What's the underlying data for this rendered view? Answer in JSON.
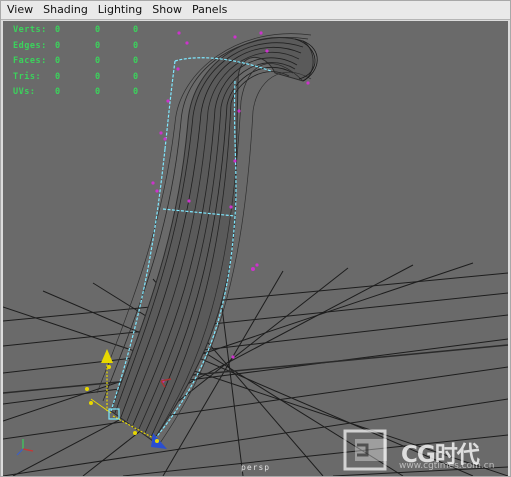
{
  "menubar": {
    "items": [
      "View",
      "Shading",
      "Lighting",
      "Show",
      "Panels"
    ]
  },
  "hud": {
    "rows": [
      {
        "label": "Verts:",
        "values": [
          "0",
          "0",
          "0"
        ]
      },
      {
        "label": "Edges:",
        "values": [
          "0",
          "0",
          "0"
        ]
      },
      {
        "label": "Faces:",
        "values": [
          "0",
          "0",
          "0"
        ]
      },
      {
        "label": "Tris:",
        "values": [
          "0",
          "0",
          "0"
        ]
      },
      {
        "label": "UVs:",
        "values": [
          "0",
          "0",
          "0"
        ]
      }
    ]
  },
  "viewport": {
    "camera_label": "persp",
    "background": "#6a6a6a",
    "grid_color": "#1d1d1d",
    "axis_x_color": "#a33",
    "axis_z_color": "#3a5fc9",
    "selection_color": "#7fe8ff",
    "vertex_color": "#cc33cc"
  },
  "watermark": {
    "text": "CG时代",
    "url": "www.cgtimes.com.cn"
  }
}
